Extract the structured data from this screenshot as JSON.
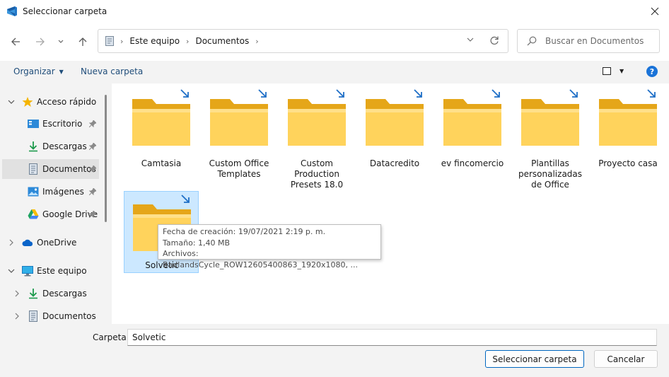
{
  "window": {
    "title": "Seleccionar carpeta",
    "accent_color": "#0067c0",
    "folder_color": "#ffc83d"
  },
  "address": {
    "segments": [
      "Este equipo",
      "Documentos"
    ]
  },
  "search": {
    "placeholder": "Buscar en Documentos"
  },
  "toolbar": {
    "organize_label": "Organizar",
    "new_folder_label": "Nueva carpeta"
  },
  "sidebar": {
    "items": [
      {
        "label": "Acceso rápido",
        "icon": "star-icon"
      },
      {
        "label": "Escritorio",
        "icon": "desktop-icon"
      },
      {
        "label": "Descargas",
        "icon": "download-icon"
      },
      {
        "label": "Documentos",
        "icon": "document-icon"
      },
      {
        "label": "Imágenes",
        "icon": "pictures-icon"
      },
      {
        "label": "Google Drive",
        "icon": "google-drive-icon"
      },
      {
        "label": "OneDrive",
        "icon": "cloud-icon"
      },
      {
        "label": "Este equipo",
        "icon": "computer-icon"
      },
      {
        "label": "Descargas",
        "icon": "download-icon"
      },
      {
        "label": "Documentos",
        "icon": "document-icon"
      }
    ]
  },
  "folders": [
    {
      "name": "Camtasia"
    },
    {
      "name": "Custom Office Templates"
    },
    {
      "name": "Custom Production Presets 18.0"
    },
    {
      "name": "Datacredito"
    },
    {
      "name": "ev fincomercio"
    },
    {
      "name": "Plantillas personalizadas de Office"
    },
    {
      "name": "Proyecto casa"
    },
    {
      "name": "Solvetic"
    }
  ],
  "tooltip": {
    "created": "Fecha de creación: 19/07/2021 2:19 p. m.",
    "size": "Tamaño: 1,40 MB",
    "files": "Archivos: BadlandsCycle_ROW12605400863_1920x1080, ..."
  },
  "bottom": {
    "folder_label": "Carpeta:",
    "folder_value": "Solvetic",
    "select_button": "Seleccionar carpeta",
    "cancel_button": "Cancelar"
  }
}
